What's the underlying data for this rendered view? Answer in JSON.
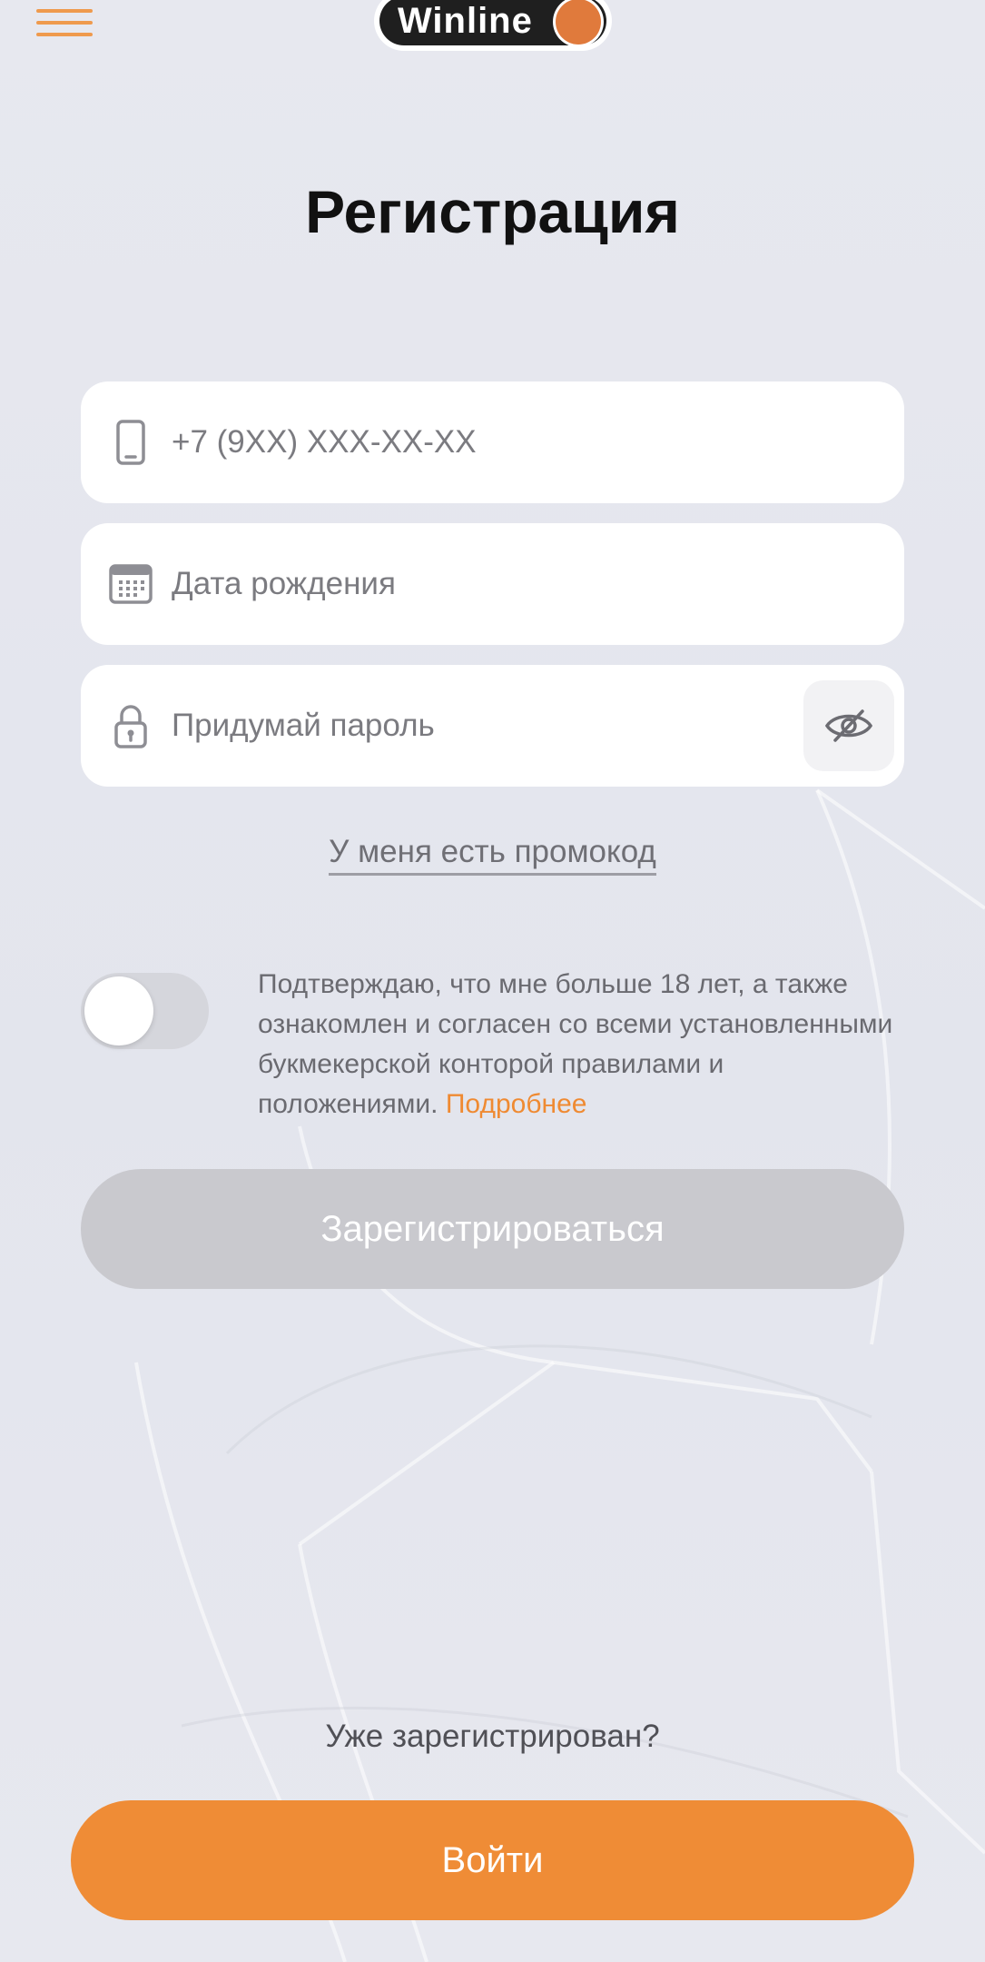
{
  "header": {
    "menu_icon": "hamburger-menu-icon",
    "logo_text": "Winline"
  },
  "title": "Регистрация",
  "form": {
    "phone": {
      "placeholder": "+7 (9XX) XXX-XX-XX",
      "value": "",
      "icon": "phone-icon"
    },
    "birthdate": {
      "placeholder": "Дата рождения",
      "value": "",
      "icon": "calendar-icon"
    },
    "password": {
      "placeholder": "Придумай пароль",
      "value": "",
      "icon": "lock-icon",
      "toggle_icon": "eye-crossed-icon"
    },
    "promo_link": "У меня есть промокод"
  },
  "consent": {
    "toggle_on": false,
    "text": "Подтверждаю, что мне больше 18 лет, а также ознакомлен и согласен со всеми установленными букмекерской конторой правилами и положениями.",
    "more_link": "Подробнее"
  },
  "register_button": "Зарегистрироваться",
  "login": {
    "question": "Уже зарегистрирован?",
    "button": "Войти"
  },
  "colors": {
    "accent": "#ef8c36",
    "background": "#e6e7ee",
    "disabled_button": "#c9c9ce",
    "logo_dark": "#1f1f1f"
  }
}
